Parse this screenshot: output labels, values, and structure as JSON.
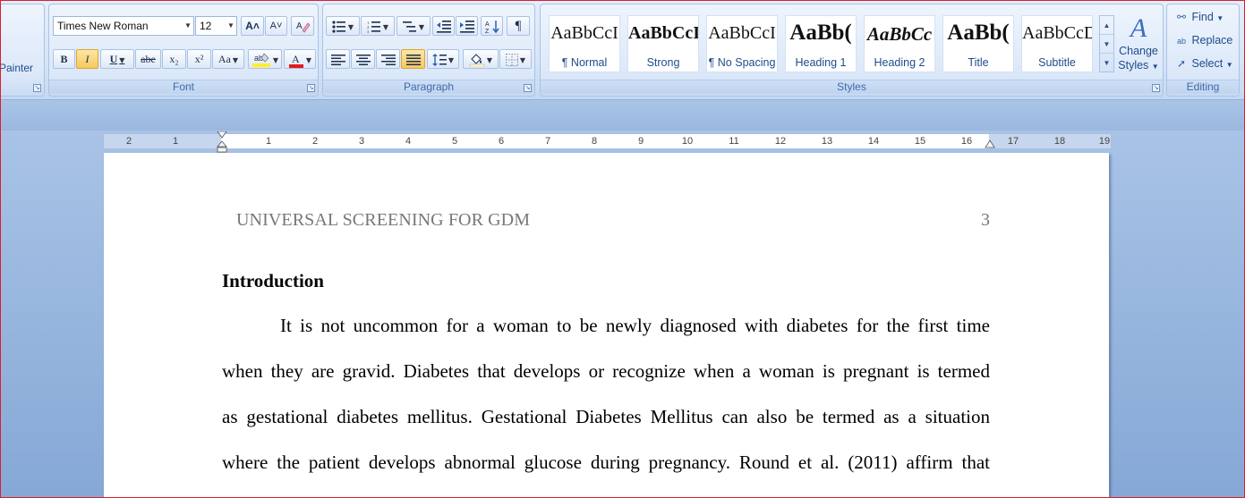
{
  "clipboard": {
    "format_painter_label": "Painter"
  },
  "font": {
    "group_label": "Font",
    "name_value": "Times New Roman",
    "size_value": "12",
    "buttons": {
      "bold": "B",
      "italic": "I",
      "underline": "U",
      "strike": "abe",
      "subscript": "x₂",
      "superscript": "x²",
      "change_case": "Aa",
      "grow": "A˄",
      "shrink": "A˅",
      "clear": "A"
    }
  },
  "paragraph": {
    "group_label": "Paragraph",
    "pilcrow": "¶"
  },
  "styles": {
    "group_label": "Styles",
    "tiles": [
      {
        "sample": "AaBbCcI",
        "name": "¶ Normal"
      },
      {
        "sample": "AaBbCcI",
        "name": "Strong"
      },
      {
        "sample": "AaBbCcI",
        "name": "¶ No Spacing"
      },
      {
        "sample": "AaBb(",
        "name": "Heading 1"
      },
      {
        "sample": "AaBbCc",
        "name": "Heading 2"
      },
      {
        "sample": "AaBb(",
        "name": "Title"
      },
      {
        "sample": "AaBbCcD",
        "name": "Subtitle"
      }
    ],
    "change_styles_line1": "Change",
    "change_styles_line2": "Styles"
  },
  "editing": {
    "group_label": "Editing",
    "find": "Find",
    "replace": "Replace",
    "select": "Select"
  },
  "ruler": {
    "labels": [
      "2",
      "1",
      "1",
      "2",
      "3",
      "4",
      "5",
      "6",
      "7",
      "8",
      "9",
      "10",
      "11",
      "12",
      "13",
      "14",
      "15",
      "16",
      "17",
      "18",
      "19"
    ]
  },
  "document": {
    "running_head": "UNIVERSAL SCREENING FOR GDM",
    "page_number": "3",
    "heading": "Introduction",
    "lines": [
      "It is not uncommon for a woman to be newly diagnosed with diabetes for the first time",
      "when they are gravid. Diabetes that develops  or recognize when a woman  is pregnant is termed",
      "as gestational diabetes mellitus. Gestational Diabetes Mellitus can also be termed as a situation",
      "where the patient develops abnormal glucose during pregnancy. Round et al. (2011) affirm  that"
    ]
  },
  "colors": {
    "ribbon_text": "#1f4c8a",
    "highlight_yellow": "#ffef2b",
    "font_red": "#e31b1b",
    "active_button": "#f7c85d"
  }
}
